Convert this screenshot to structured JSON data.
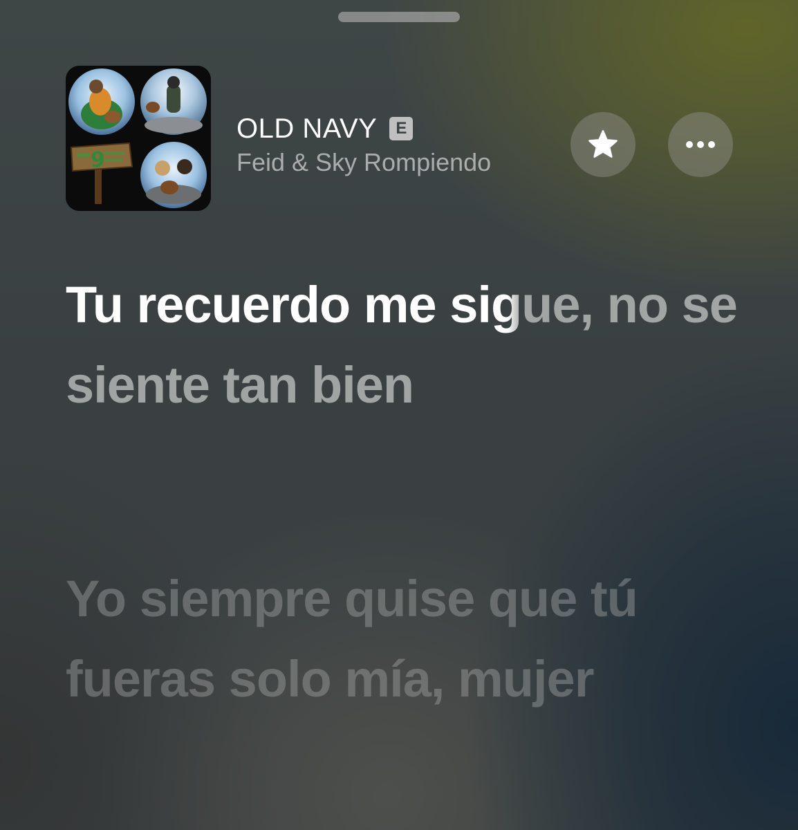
{
  "now_playing": {
    "title": "OLD NAVY",
    "explicit_badge": "E",
    "artist": "Feid & Sky Rompiendo",
    "artwork_icon": "album-artwork"
  },
  "controls": {
    "favorite_icon": "star-icon",
    "more_icon": "ellipsis-icon"
  },
  "lyrics": {
    "current_line": {
      "sung_part": "Tu recuerdo me si",
      "transition_part": "g",
      "remaining_part": "ue, no se siente tan bien"
    },
    "next_line": "Yo siempre quise que tú fueras solo mía, mujer"
  },
  "colors": {
    "sung_text": "#ffffff",
    "explicit_badge": "#cdcdcd"
  }
}
